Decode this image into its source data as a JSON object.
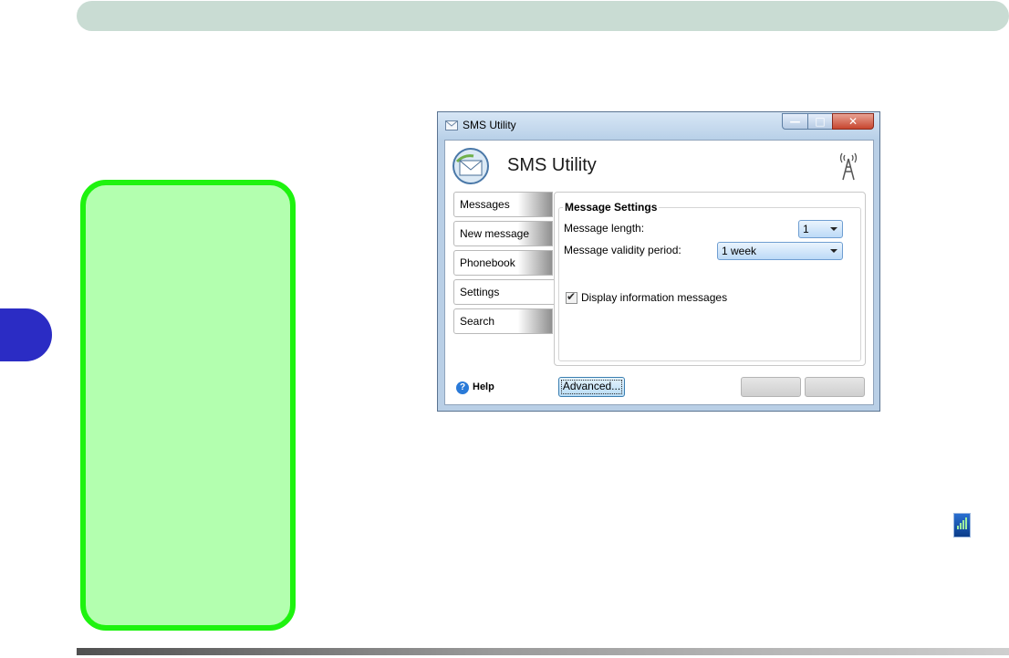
{
  "window": {
    "title": "SMS Utility",
    "app_title": "SMS Utility",
    "controls": [
      "minimize",
      "maximize",
      "close"
    ]
  },
  "nav": {
    "items": [
      {
        "label": "Messages",
        "active": false
      },
      {
        "label": "New message",
        "active": false
      },
      {
        "label": "Phonebook",
        "active": false
      },
      {
        "label": "Settings",
        "active": true
      },
      {
        "label": "Search",
        "active": false
      }
    ],
    "help_label": "Help"
  },
  "settings": {
    "group_title": "Message Settings",
    "length_label": "Message length:",
    "length_value": "1",
    "validity_label": "Message validity period:",
    "validity_value": "1 week",
    "display_info_label": "Display information messages",
    "display_info_checked": true
  },
  "buttons": {
    "advanced": "Advanced...",
    "disabled_1": "",
    "disabled_2": ""
  },
  "icons": {
    "title_icon": "envelope-icon",
    "app_logo": "envelope-globe-icon",
    "signal": "antenna-tower-icon",
    "help": "help-icon",
    "tray": "signal-bars-icon"
  },
  "colors": {
    "header_bar": "#c9dcd3",
    "chapter_tab": "#2b2cc4",
    "callout_fill": "#b3ffaf",
    "callout_border": "#1ef30f"
  }
}
